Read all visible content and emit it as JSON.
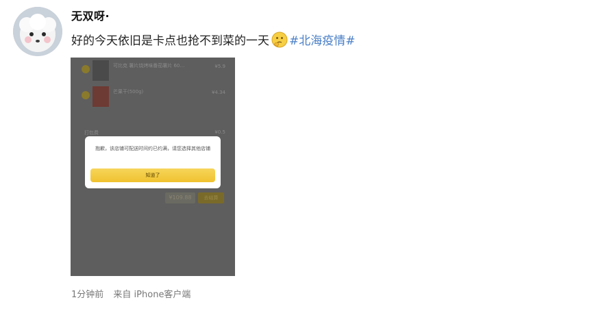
{
  "post": {
    "username": "无双呀·",
    "text": "好的今天依旧是卡点也抢不到菜的一天",
    "hashtag": "#北海疫情#",
    "timestamp": "1分钟前",
    "source": "来自 iPhone客户端"
  },
  "embedded_screenshot": {
    "items": [
      {
        "name": "可比克 薯片烧烤味番茄薯片 60…",
        "price": "¥5.9"
      },
      {
        "name": "芒果干(500g)",
        "price": "¥4.34"
      }
    ],
    "row_label": "打包费",
    "row_price": "¥0.5",
    "dialog_message": "抱歉，该店铺可配送时间约已约满，请您选择其他店铺",
    "dialog_button": "知道了",
    "total": "¥109.88",
    "checkout_label": "去结算"
  },
  "colors": {
    "hashtag": "#4a7fc6",
    "dialog_button": "#f0c22f",
    "overlay": "#5e5e5e"
  },
  "icons": {
    "emoji": "thinking-face-icon"
  }
}
